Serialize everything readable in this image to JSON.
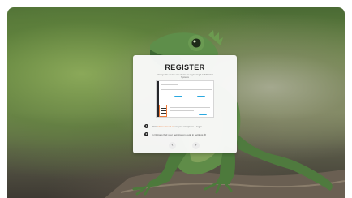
{
  "card": {
    "title": "REGISTER",
    "subtitle": "Manage this device as a device for registering it in XTOUCH Systems",
    "steps": [
      {
        "number": "1",
        "text_before": "Visit ",
        "link": "admin.xtouch.io",
        "text_after": " on your computer & login"
      },
      {
        "number": "2",
        "text": "In Options find your registration code in settings ⚙"
      }
    ],
    "prev_glyph": "‹",
    "next_glyph": "›"
  },
  "icons": {
    "prev": "chevron-left-icon",
    "next": "chevron-right-icon"
  },
  "colors": {
    "accent": "#f07c3a",
    "highlight_blue": "#2aa8e0",
    "card_background": "#fafafa"
  }
}
